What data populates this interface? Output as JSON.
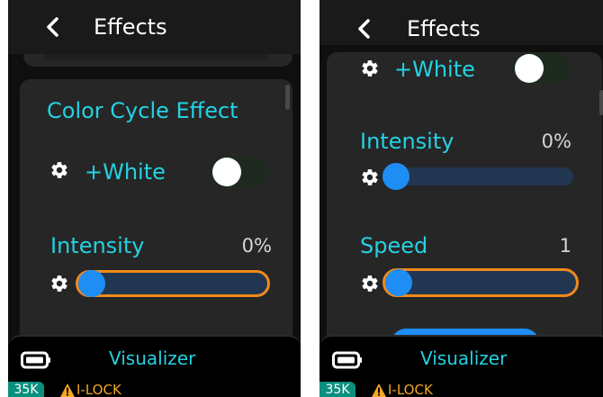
{
  "colors": {
    "accent_cyan": "#24d2e2",
    "slider_knob": "#1f8ef4",
    "focus_outline": "#f08a1a",
    "warning": "#f5a623",
    "badge_bg": "#0b8f7f"
  },
  "screens": [
    {
      "header": {
        "title": "Effects",
        "back_icon": "chevron-left-icon"
      },
      "section_title": "Color Cycle Effect",
      "white_toggle": {
        "label": "+White",
        "icon": "gear-icon",
        "on": false
      },
      "intensity": {
        "label": "Intensity",
        "value_text": "0%",
        "level": 0,
        "focused": true
      },
      "footer": {
        "battery_icon": "battery-icon",
        "title": "Visualizer",
        "badge": "35K",
        "warning_icon": "warning-icon",
        "lock_label": "I-LOCK"
      }
    },
    {
      "header": {
        "title": "Effects",
        "back_icon": "chevron-left-icon"
      },
      "white_toggle": {
        "label": "+White",
        "icon": "gear-icon",
        "on": false
      },
      "intensity": {
        "label": "Intensity",
        "value_text": "0%",
        "level": 0,
        "focused": false
      },
      "speed": {
        "label": "Speed",
        "value_text": "1",
        "level": 0,
        "focused": true
      },
      "footer": {
        "battery_icon": "battery-icon",
        "title": "Visualizer",
        "badge": "35K",
        "warning_icon": "warning-icon",
        "lock_label": "I-LOCK"
      }
    }
  ]
}
